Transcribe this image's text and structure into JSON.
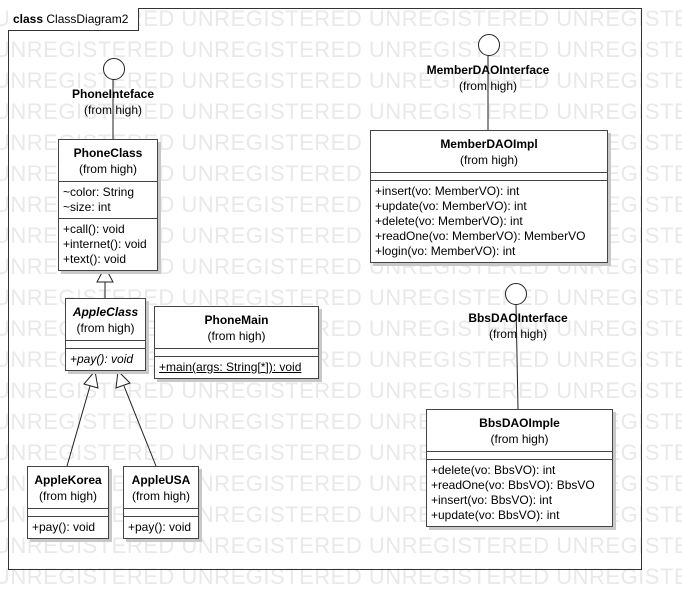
{
  "frame": {
    "kind": "class",
    "title": "ClassDiagram2"
  },
  "watermark": "UNREGISTERED UNREGISTERED UNREGISTERED UNREGISTERED UNREGISTERED",
  "interfaces": [
    {
      "id": "phone-inteface",
      "name": "PhoneInteface",
      "from": "(from high)"
    },
    {
      "id": "member-dao-interface",
      "name": "MemberDAOInterface",
      "from": "(from high)"
    },
    {
      "id": "bbs-dao-interface",
      "name": "BbsDAOInterface",
      "from": "(from high)"
    }
  ],
  "classes": {
    "phone_class": {
      "name": "PhoneClass",
      "from": "(from high)",
      "attributes": [
        "~color: String",
        "~size: int"
      ],
      "operations": [
        "+call(): void",
        "+internet(): void",
        "+text(): void"
      ]
    },
    "apple_class": {
      "name": "AppleClass",
      "from": "(from high)",
      "abstract": true,
      "operations": [
        "+pay(): void"
      ]
    },
    "phone_main": {
      "name": "PhoneMain",
      "from": "(from high)",
      "operations": [
        "+main(args: String[*]): void"
      ]
    },
    "apple_korea": {
      "name": "AppleKorea",
      "from": "(from high)",
      "operations": [
        "+pay(): void"
      ]
    },
    "apple_usa": {
      "name": "AppleUSA",
      "from": "(from high)",
      "operations": [
        "+pay(): void"
      ]
    },
    "member_dao_impl": {
      "name": "MemberDAOImpl",
      "from": "(from high)",
      "operations": [
        "+insert(vo: MemberVO): int",
        "+update(vo: MemberVO): int",
        "+delete(vo: MemberVO): int",
        "+readOne(vo: MemberVO): MemberVO",
        "+login(vo: MemberVO): int"
      ]
    },
    "bbs_dao_imple": {
      "name": "BbsDAOImple",
      "from": "(from high)",
      "operations": [
        "+delete(vo: BbsVO): int",
        "+readOne(vo: BbsVO): BbsVO",
        "+insert(vo: BbsVO): int",
        "+update(vo: BbsVO): int"
      ]
    }
  },
  "relations": [
    {
      "type": "realization-lollipop",
      "from": "PhoneClass",
      "to": "PhoneInteface"
    },
    {
      "type": "realization-lollipop",
      "from": "MemberDAOImpl",
      "to": "MemberDAOInterface"
    },
    {
      "type": "realization-lollipop",
      "from": "BbsDAOImple",
      "to": "BbsDAOInterface"
    },
    {
      "type": "generalization",
      "from": "AppleClass",
      "to": "PhoneClass"
    },
    {
      "type": "generalization",
      "from": "AppleKorea",
      "to": "AppleClass"
    },
    {
      "type": "generalization",
      "from": "AppleUSA",
      "to": "AppleClass"
    }
  ]
}
